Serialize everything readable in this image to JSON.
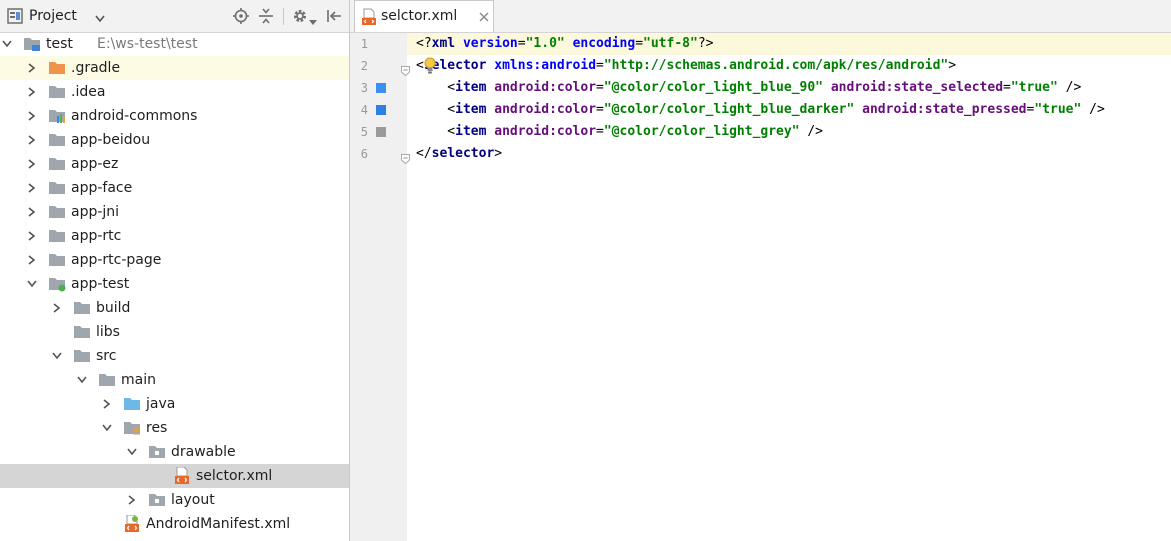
{
  "project_panel": {
    "title": "Project",
    "icons": [
      "locate-icon",
      "collapse-all-icon",
      "settings-icon",
      "hide-panel-icon"
    ],
    "tree": [
      {
        "name": "tree-item-test",
        "label": "test",
        "hint": "E:\\ws-test\\test",
        "depth": 0,
        "expanded": true,
        "icon": "project-icon"
      },
      {
        "name": "tree-item-gradle",
        "label": ".gradle",
        "depth": 1,
        "expanded": false,
        "icon": "folder-orange-icon"
      },
      {
        "name": "tree-item-idea",
        "label": ".idea",
        "depth": 1,
        "expanded": false,
        "icon": "folder-icon"
      },
      {
        "name": "tree-item-android-commons",
        "label": "android-commons",
        "depth": 1,
        "expanded": false,
        "icon": "module-library-icon"
      },
      {
        "name": "tree-item-app-beidou",
        "label": "app-beidou",
        "depth": 1,
        "expanded": false,
        "icon": "folder-icon"
      },
      {
        "name": "tree-item-app-ez",
        "label": "app-ez",
        "depth": 1,
        "expanded": false,
        "icon": "folder-icon"
      },
      {
        "name": "tree-item-app-face",
        "label": "app-face",
        "depth": 1,
        "expanded": false,
        "icon": "folder-icon"
      },
      {
        "name": "tree-item-app-jni",
        "label": "app-jni",
        "depth": 1,
        "expanded": false,
        "icon": "folder-icon"
      },
      {
        "name": "tree-item-app-rtc",
        "label": "app-rtc",
        "depth": 1,
        "expanded": false,
        "icon": "folder-icon"
      },
      {
        "name": "tree-item-app-rtc-page",
        "label": "app-rtc-page",
        "depth": 1,
        "expanded": false,
        "icon": "folder-icon"
      },
      {
        "name": "tree-item-app-test",
        "label": "app-test",
        "depth": 1,
        "expanded": true,
        "icon": "module-app-icon"
      },
      {
        "name": "tree-item-build",
        "label": "build",
        "depth": 2,
        "expanded": false,
        "icon": "folder-icon"
      },
      {
        "name": "tree-item-libs",
        "label": "libs",
        "depth": 2,
        "expanded": null,
        "icon": "folder-icon"
      },
      {
        "name": "tree-item-src",
        "label": "src",
        "depth": 2,
        "expanded": true,
        "icon": "folder-icon"
      },
      {
        "name": "tree-item-main",
        "label": "main",
        "depth": 3,
        "expanded": true,
        "icon": "folder-icon"
      },
      {
        "name": "tree-item-java",
        "label": "java",
        "depth": 4,
        "expanded": false,
        "icon": "folder-source-icon"
      },
      {
        "name": "tree-item-res",
        "label": "res",
        "depth": 4,
        "expanded": true,
        "icon": "folder-resource-icon"
      },
      {
        "name": "tree-item-drawable",
        "label": "drawable",
        "depth": 5,
        "expanded": true,
        "icon": "folder-package-icon"
      },
      {
        "name": "tree-item-selctor-xml",
        "label": "selctor.xml",
        "depth": 6,
        "expanded": null,
        "icon": "xml-file-icon",
        "selected": true
      },
      {
        "name": "tree-item-layout",
        "label": "layout",
        "depth": 5,
        "expanded": false,
        "icon": "folder-package-icon"
      },
      {
        "name": "tree-item-android-manifest",
        "label": "AndroidManifest.xml",
        "depth": 4,
        "expanded": null,
        "icon": "manifest-file-icon"
      }
    ]
  },
  "editor": {
    "tab": {
      "label": "selctor.xml",
      "icon": "xml-file-icon",
      "close": "close-icon"
    },
    "line_numbers": [
      "1",
      "2",
      "3",
      "4",
      "5",
      "6"
    ],
    "lines": [
      [
        [
          "punc",
          "<?"
        ],
        [
          "tag",
          "xml "
        ],
        [
          "attr-ns",
          "version"
        ],
        [
          "punc",
          "="
        ],
        [
          "str",
          "\"1.0\" "
        ],
        [
          "attr-ns",
          "encoding"
        ],
        [
          "punc",
          "="
        ],
        [
          "str",
          "\"utf-8\""
        ],
        [
          "punc",
          "?>"
        ]
      ],
      [
        [
          "punc",
          "<"
        ],
        [
          "tag",
          "selector "
        ],
        [
          "attr-ns",
          "xmlns:android"
        ],
        [
          "punc",
          "="
        ],
        [
          "str",
          "\"http://schemas.android.com/apk/res/android\""
        ],
        [
          "punc",
          ">"
        ]
      ],
      [
        [
          "punc",
          "    <"
        ],
        [
          "tag",
          "item "
        ],
        [
          "attr",
          "android:color"
        ],
        [
          "punc",
          "="
        ],
        [
          "str",
          "\"@color/color_light_blue_90\" "
        ],
        [
          "attr",
          "android:state_selected"
        ],
        [
          "punc",
          "="
        ],
        [
          "str",
          "\"true\" "
        ],
        [
          "punc",
          "/>"
        ]
      ],
      [
        [
          "punc",
          "    <"
        ],
        [
          "tag",
          "item "
        ],
        [
          "attr",
          "android:color"
        ],
        [
          "punc",
          "="
        ],
        [
          "str",
          "\"@color/color_light_blue_darker\" "
        ],
        [
          "attr",
          "android:state_pressed"
        ],
        [
          "punc",
          "="
        ],
        [
          "str",
          "\"true\" "
        ],
        [
          "punc",
          "/>"
        ]
      ],
      [
        [
          "punc",
          "    <"
        ],
        [
          "tag",
          "item "
        ],
        [
          "attr",
          "android:color"
        ],
        [
          "punc",
          "="
        ],
        [
          "str",
          "\"@color/color_light_grey\" "
        ],
        [
          "punc",
          "/>"
        ]
      ],
      [
        [
          "punc",
          "</"
        ],
        [
          "tag",
          "selector"
        ],
        [
          "punc",
          ">"
        ]
      ]
    ],
    "swatches": [
      {
        "line": 3,
        "color": "#3b8ff0"
      },
      {
        "line": 4,
        "color": "#2f7fe0"
      },
      {
        "line": 5,
        "color": "#9a9a9a"
      }
    ],
    "intention_icon": "lightbulb-icon"
  }
}
